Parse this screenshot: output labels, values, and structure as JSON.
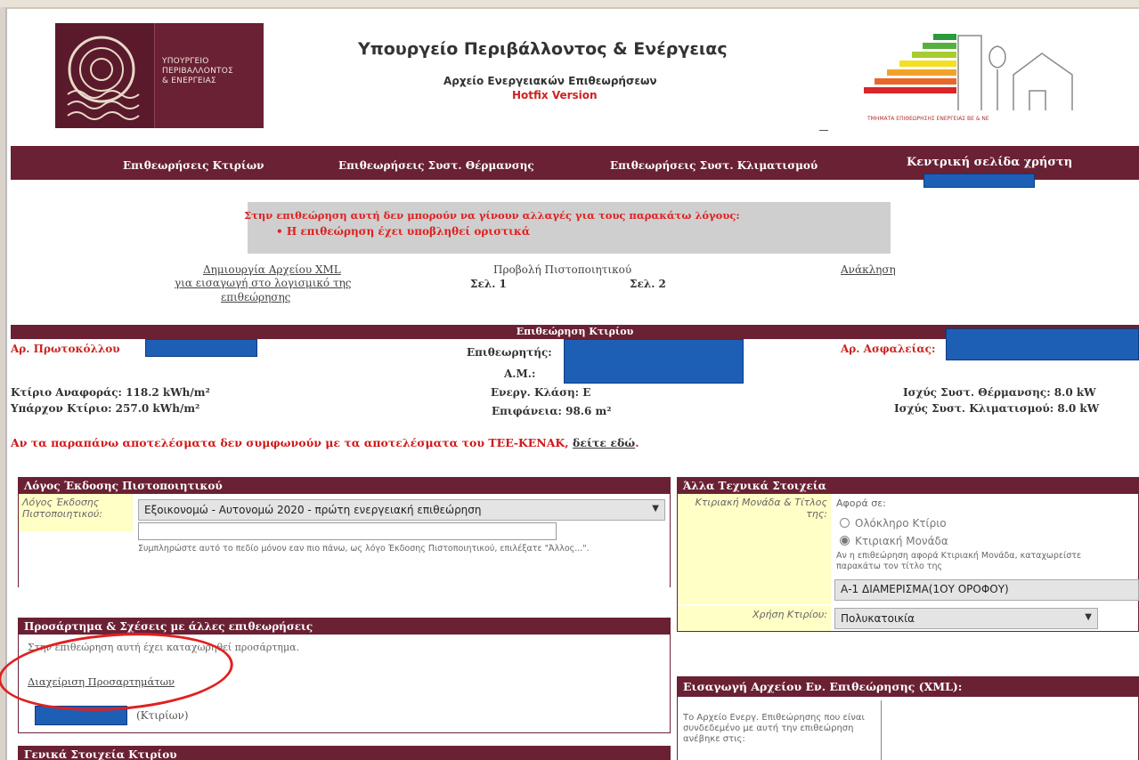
{
  "header": {
    "logo_text_lines": [
      "ΥΠΟΥΡΓΕΙΟ",
      "ΠΕΡΙΒΑΛΛΟΝΤΟΣ",
      "& ΕΝΕΡΓΕΙΑΣ"
    ],
    "title": "Υπουργείο Περιβάλλοντος & Ενέργειας",
    "subtitle": "Αρχείο Ενεργειακών Επιθεωρήσεων",
    "version": "Hotfix Version",
    "energy_caption": "ΤΜΗΜΑΤΑ ΕΠΙΘΕΩΡΗΣΗΣ ΕΝΕΡΓΕΙΑΣ ΒΕ & ΝΕ",
    "energy_bar_colors": [
      "#2a9a3a",
      "#56b040",
      "#a8cc30",
      "#f3e020",
      "#f2a22a",
      "#e8682a",
      "#d8262a"
    ]
  },
  "nav": {
    "items": [
      "Επιθεωρήσεις Κτιρίων",
      "Επιθεωρήσεις Συστ. Θέρμανσης",
      "Επιθεωρήσεις Συστ. Κλιματισμού"
    ],
    "user_home": "Κεντρική σελίδα χρήστη"
  },
  "alert": {
    "line1": "Στην επιθεώρηση αυτή δεν μπορούν να γίνουν αλλαγές για τους παρακάτω λόγους:",
    "line2": "• Η επιθεώρηση έχει υποβληθεί οριστικά"
  },
  "actions": {
    "xml_line1": "Δημιουργία Αρχείου XML",
    "xml_line2": "για εισαγωγή στο λογισμικό της",
    "xml_line3": "επιθεώρησης",
    "preview_label": "Προβολή Πιστοποιητικού",
    "page1": "Σελ. 1",
    "page2": "Σελ. 2",
    "revoke": "Ανάκληση"
  },
  "inspection": {
    "banner": "Επιθεώρηση Κτιρίου",
    "protocol_label": "Αρ. Πρωτοκόλλου",
    "inspector_label": "Επιθεωρητής:",
    "am_label": "Α.Μ.:",
    "insurance_label": "Αρ. Ασφαλείας:",
    "ref_building": "Κτίριο Αναφοράς: 118.2 kWh/m²",
    "existing_building": "Υπάρχον Κτίριο: 257.0 kWh/m²",
    "energy_class": "Ενεργ. Κλάση: Ε",
    "area": "Επιφάνεια: 98.6 m²",
    "heating_power": "Ισχύς Συστ. Θέρμανσης: 8.0 kW",
    "cooling_power": "Ισχύς Συστ. Κλιματισμού: 8.0 kW",
    "warning": "Αν τα παραπάνω αποτελέσματα δεν συμφωνούν με τα αποτελέσματα του ΤΕΕ-ΚΕΝΑΚ,",
    "warning_link": "δείτε εδώ"
  },
  "reason_panel": {
    "title": "Λόγος Έκδοσης Πιστοποιητικού",
    "field_label": "Λόγος Έκδοσης Πιστοποιητικού:",
    "selected": "Εξοικονομώ - Αυτονομώ 2020 - πρώτη ενεργειακή επιθεώρηση",
    "help": "Συμπληρώστε αυτό το πεδίο μόνον εαν πιο πάνω, ως λόγο Έκδοσης Πιστοποιητικού, επιλέξατε \"Άλλος...\"."
  },
  "attachments_panel": {
    "title": "Προσάρτημα & Σχέσεις με άλλες επιθεωρήσεις",
    "note": "Στην επιθεώρηση αυτή έχει καταχωρηθεί προσάρτημα.",
    "manage_link": "Διαχείριση Προσαρτημάτων",
    "related_suffix": "(Κτιρίων)"
  },
  "general_panel": {
    "title": "Γενικά Στοιχεία Κτιρίου"
  },
  "tech_panel": {
    "title": "Άλλα Τεχνικά Στοιχεία",
    "unit_label": "Κτιριακή Μονάδα & Τίτλος της:",
    "concerns": "Αφορά σε:",
    "option_whole": "Ολόκληρο Κτίριο",
    "option_unit": "Κτιριακή Μονάδα",
    "unit_help": "Αν η επιθεώρηση αφορά Κτιριακή Μονάδα, καταχωρείστε παρακάτω τον τίτλο της",
    "unit_title_value": "Α-1 ΔΙΑΜΕΡΙΣΜΑ(1ΟΥ ΟΡΟΦΟΥ)",
    "use_label": "Χρήση Κτιρίου:",
    "use_value": "Πολυκατοικία"
  },
  "xml_panel": {
    "title": "Εισαγωγή Αρχείου Εν. Επιθεώρησης (XML):",
    "text": "Το Αρχείο Ενεργ. Επιθεώρησης που είναι συνδεδεμένο με αυτή την επιθεώρηση ανέβηκε στις:"
  },
  "annotation_color": "#e02020"
}
